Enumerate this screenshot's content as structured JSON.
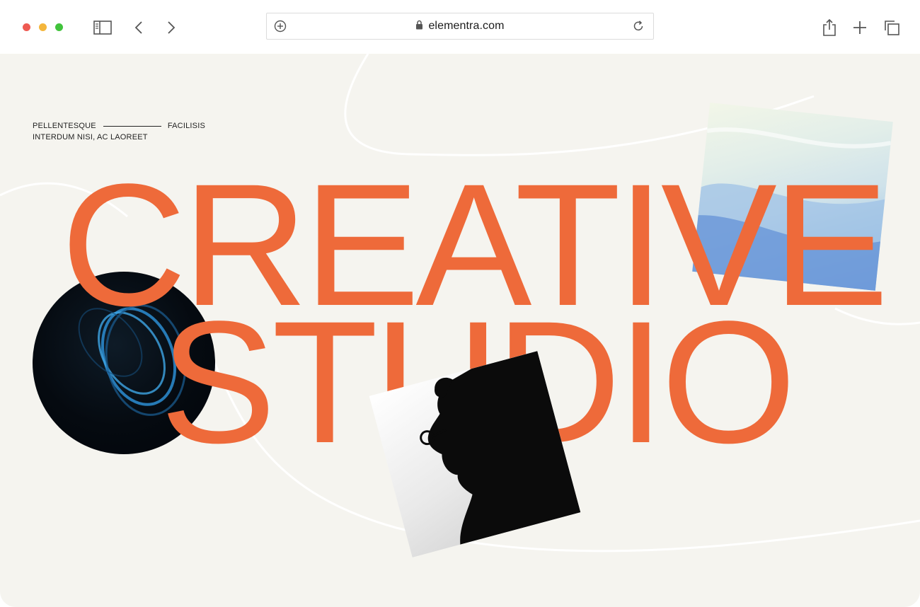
{
  "browser": {
    "url": "elementra.com",
    "icons": {
      "sidebar": "sidebar-icon",
      "back": "chevron-left-icon",
      "forward": "chevron-right-icon",
      "add_tab_in_bar": "plus-circle-icon",
      "lock": "lock-icon",
      "reload": "reload-icon",
      "share": "share-icon",
      "new_tab": "plus-icon",
      "tabs": "tabs-icon"
    }
  },
  "hero": {
    "eyebrow_left": "PELLENTESQUE",
    "eyebrow_right": "FACILISIS",
    "eyebrow_sub": "INTERDUM NISI, AC LAOREET",
    "headline_line1": "CREATIVE",
    "headline_line2": "STUDIO"
  },
  "colors": {
    "accent": "#ee6a3a",
    "background": "#f5f4ef",
    "text": "#222222"
  }
}
